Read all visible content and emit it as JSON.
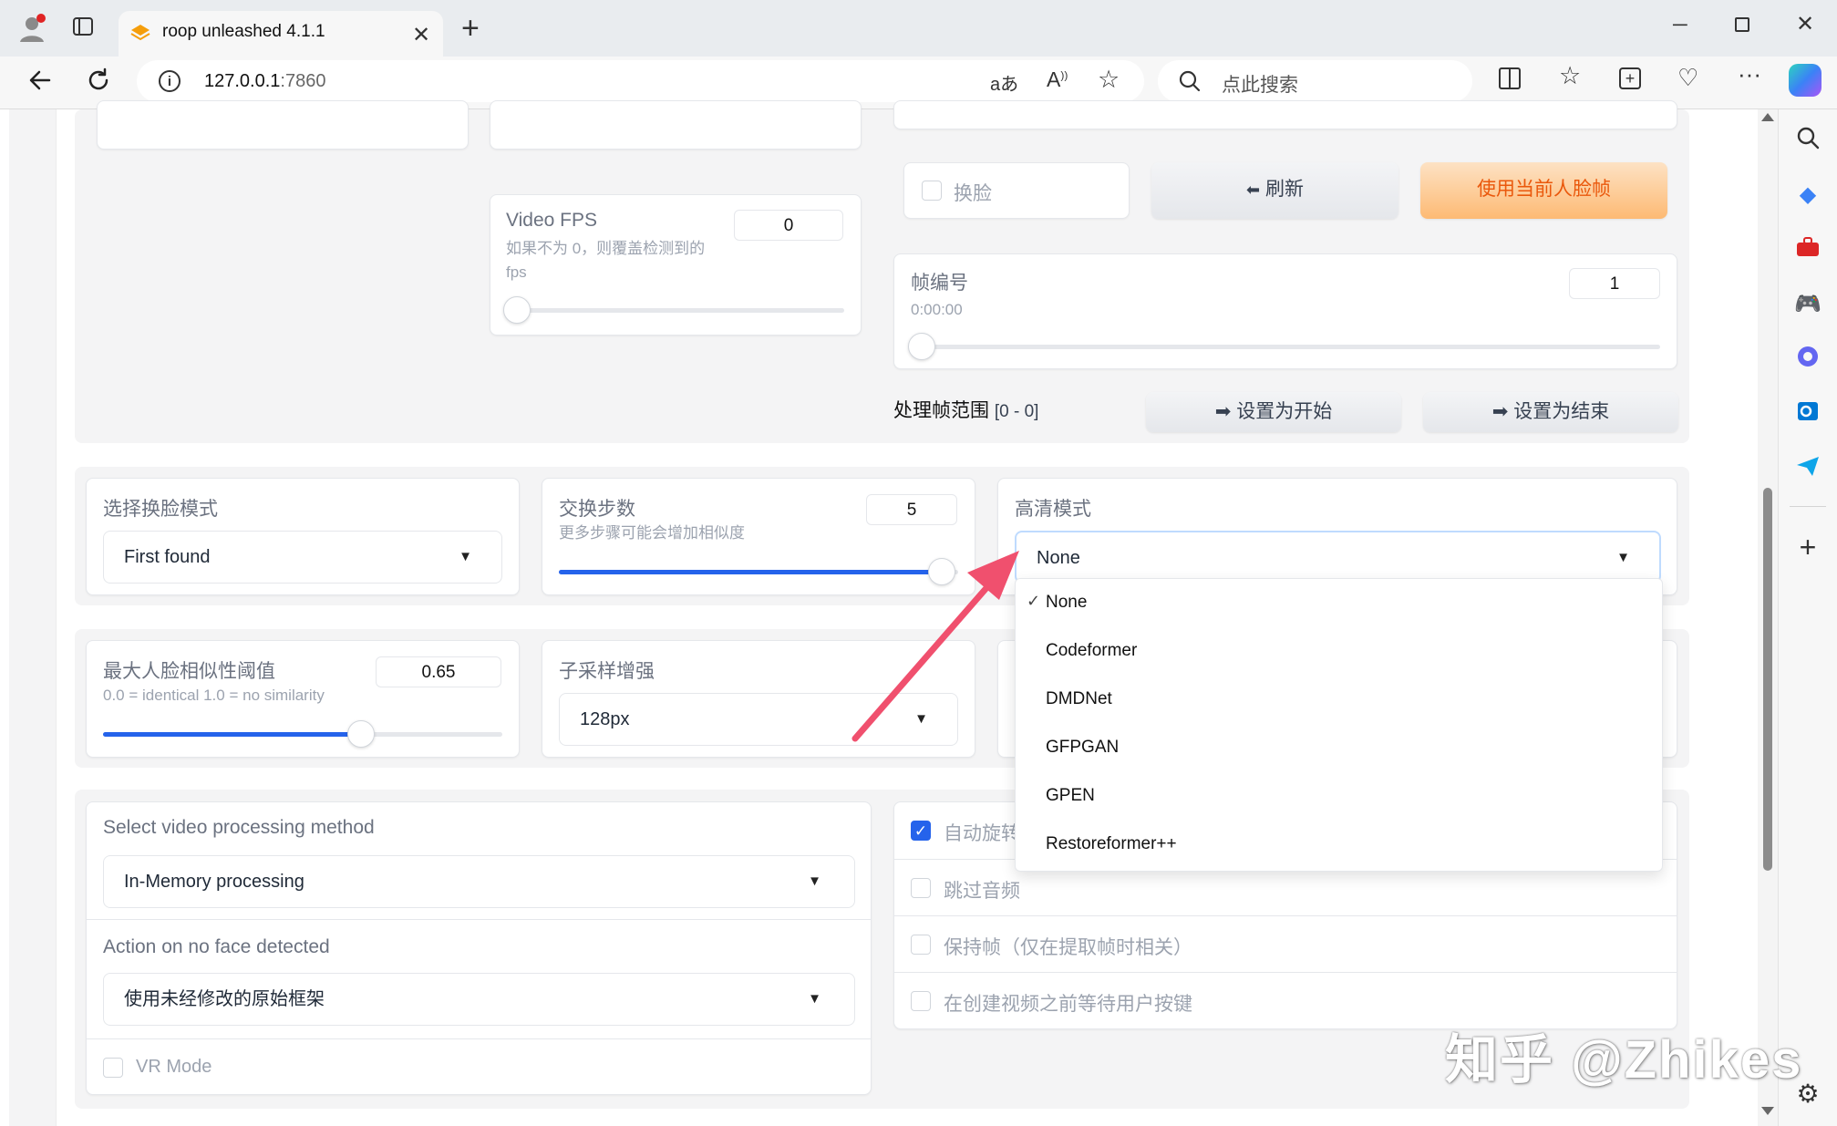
{
  "browser": {
    "tab_title": "roop unleashed 4.1.1",
    "url_host": "127.0.0.1",
    "url_port": ":7860",
    "search_placeholder": "点此搜索",
    "icons": [
      "profile-icon",
      "tab-actions-icon",
      "close-icon",
      "new-tab-icon",
      "minimize-icon",
      "maximize-icon",
      "back-icon",
      "reload-icon",
      "info-icon",
      "translate-icon",
      "read-aloud-icon",
      "favorite-icon",
      "search-icon",
      "split-screen-icon",
      "favorites-icon",
      "collections-icon",
      "browser-essentials-icon",
      "more-icon",
      "copilot-icon"
    ]
  },
  "top": {
    "video_fps": {
      "label": "Video FPS",
      "desc": "如果不为 0，则覆盖检测到的 fps",
      "value": "0"
    },
    "swap_face_checkbox": "换脸",
    "refresh_button": "刷新",
    "use_current_face_button": "使用当前人脸帧",
    "frame_number": {
      "label": "帧编号",
      "time": "0:00:00",
      "value": "1"
    },
    "frame_range": {
      "label": "处理帧范围",
      "value": "[0 - 0]"
    },
    "set_start_button": "➡ 设置为开始",
    "set_end_button": "➡ 设置为结束"
  },
  "settings": {
    "face_mode": {
      "label": "选择换脸模式",
      "value": "First found"
    },
    "swap_steps": {
      "label": "交换步数",
      "desc": "更多步骤可能会增加相似度",
      "value": "5",
      "level": 1.0
    },
    "enhance_mode": {
      "label": "高清模式",
      "value": "None",
      "options": [
        "None",
        "Codeformer",
        "DMDNet",
        "GFPGAN",
        "GPEN",
        "Restoreformer++"
      ],
      "check_mark": "✓"
    },
    "max_similarity": {
      "label": "最大人脸相似性阈值",
      "desc": "0.0 = identical 1.0 = no similarity",
      "value": "0.65",
      "level": 0.65
    },
    "subsample": {
      "label": "子采样增强",
      "value": "128px"
    }
  },
  "video": {
    "method": {
      "label": "Select video processing method",
      "value": "In-Memory processing"
    },
    "no_face": {
      "label": "Action on no face detected",
      "value": "使用未经修改的原始框架"
    },
    "vr_mode": "VR Mode",
    "checkboxes": [
      {
        "label": "自动旋转",
        "checked": true
      },
      {
        "label": "跳过音频",
        "checked": false
      },
      {
        "label": "保持帧（仅在提取帧时相关）",
        "checked": false
      },
      {
        "label": "在创建视频之前等待用户按键",
        "checked": false
      }
    ]
  },
  "watermark": "知乎 @Zhikes",
  "colors": {
    "accent": "#2563eb",
    "orange": "#fdba74",
    "arrow": "#f0506e"
  }
}
